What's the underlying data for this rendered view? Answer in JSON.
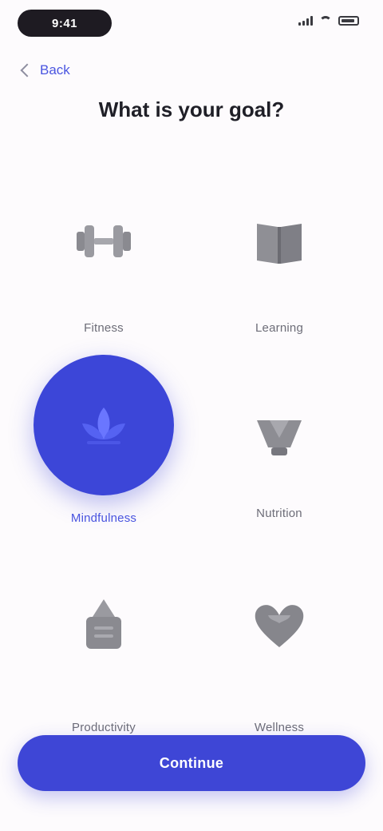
{
  "status_bar": {
    "time": "9:41"
  },
  "nav": {
    "back_label": "Back"
  },
  "page": {
    "title": "What is your goal?"
  },
  "options": [
    {
      "label": "Fitness",
      "icon": "dumbbell-icon",
      "selected": false
    },
    {
      "label": "Learning",
      "icon": "book-icon",
      "selected": false
    },
    {
      "label": "Mindfulness",
      "icon": "lotus-icon",
      "selected": true
    },
    {
      "label": "Nutrition",
      "icon": "bowl-icon",
      "selected": false
    },
    {
      "label": "Productivity",
      "icon": "clipboard-icon",
      "selected": false
    },
    {
      "label": "Wellness",
      "icon": "heart-icon",
      "selected": false
    }
  ],
  "footer": {
    "continue_label": "Continue"
  },
  "colors": {
    "accent": "#3e46d6",
    "background": "#fdfbfd",
    "muted": "#6d6d78"
  }
}
